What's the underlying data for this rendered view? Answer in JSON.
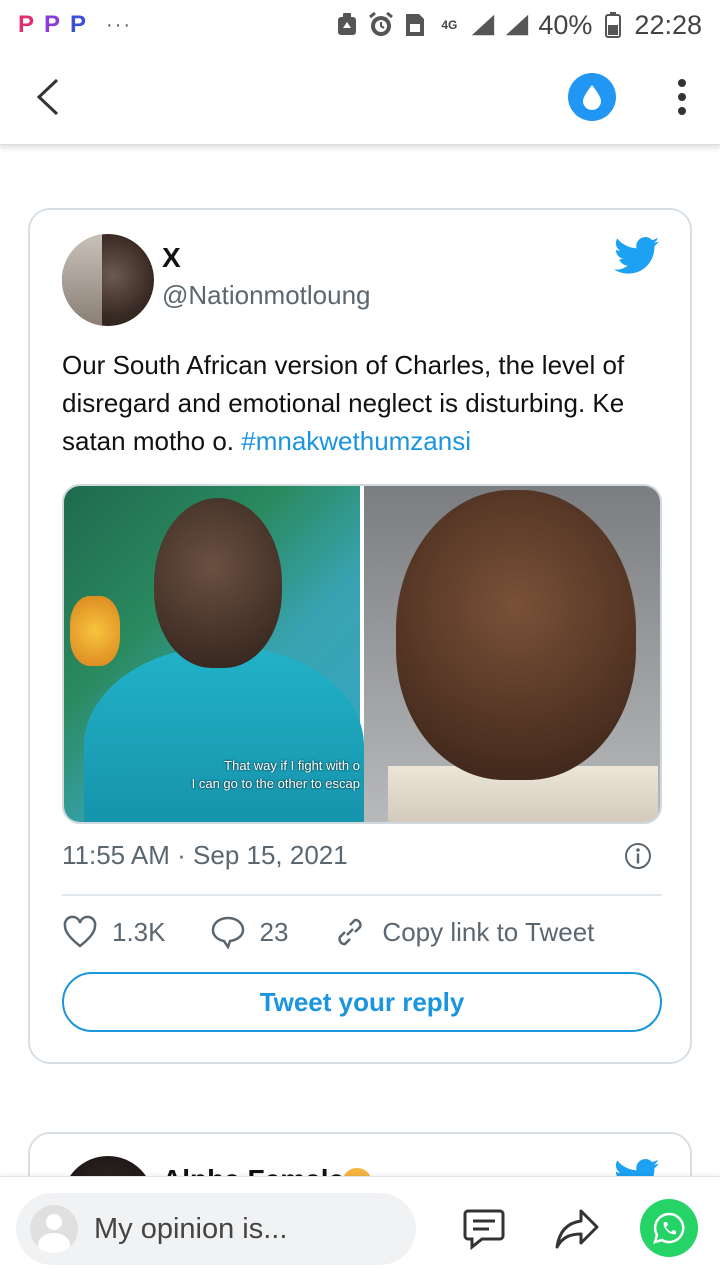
{
  "status_bar": {
    "notification_icons": [
      "P",
      "P",
      "P"
    ],
    "overflow": "···",
    "network": "4G",
    "battery": "40%",
    "time": "22:28",
    "notification_color": "#e0306a"
  },
  "app_bar": {
    "back_icon": "chevron-left-icon",
    "drop_icon": "water-drop-icon",
    "more_icon": "more-vertical-icon",
    "accent": "#2196f3"
  },
  "tweet": {
    "display_name": "X",
    "handle": "@Nationmotloung",
    "text": "Our South African version of Charles, the level of disregard and emotional neglect is disturbing. Ke satan motho o. ",
    "hashtag": "#mnakwethumzansi",
    "media_caption_line1": "That way if I fight with o",
    "media_caption_line2": "I can go to the other to escap",
    "timestamp": "11:55 AM · Sep 15, 2021",
    "likes": "1.3K",
    "replies": "23",
    "copy_link_label": "Copy link to Tweet",
    "reply_button_label": "Tweet your reply",
    "accent": "#1b95e0"
  },
  "next_tweet": {
    "display_name": "Alpha Female"
  },
  "bottom_bar": {
    "input_placeholder": "My opinion is...",
    "comment_icon": "comment-icon",
    "share_icon": "share-icon",
    "whatsapp_icon": "whatsapp-icon",
    "whatsapp_color": "#25d366"
  }
}
